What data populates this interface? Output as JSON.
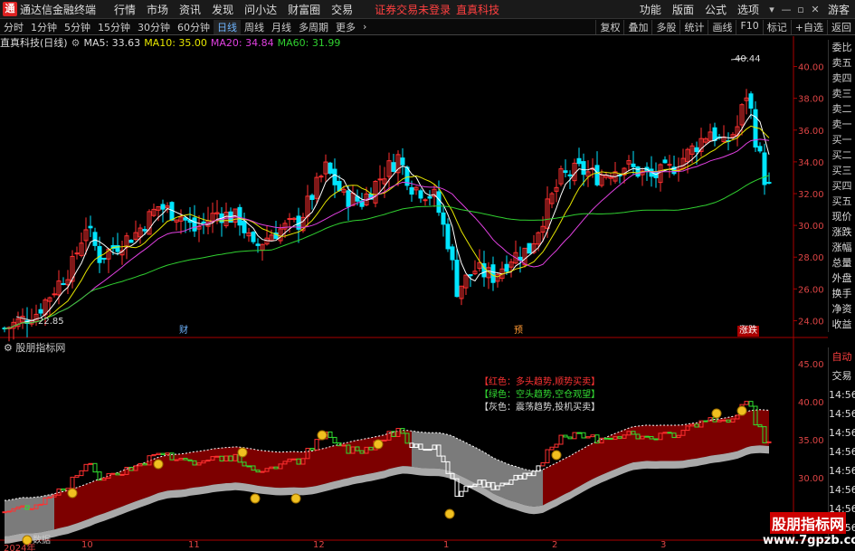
{
  "window": {
    "app_title": "通达信金融终端",
    "menus": [
      "行情",
      "市场",
      "资讯",
      "发现",
      "问小达",
      "财富圈",
      "交易"
    ],
    "warning": "证券交易未登录",
    "stock_title": "直真科技",
    "right_menus": [
      "功能",
      "版面",
      "公式",
      "选项",
      "画线"
    ],
    "guest": "游客"
  },
  "toolbar": {
    "periods": [
      "分时",
      "1分钟",
      "5分钟",
      "15分钟",
      "30分钟",
      "60分钟",
      "日线",
      "周线",
      "月线",
      "多周期",
      "更多"
    ],
    "active": "日线",
    "right_tools": [
      "复权",
      "叠加",
      "多股",
      "统计",
      "画线",
      "F10",
      "标记",
      "+自选",
      "返回"
    ]
  },
  "info": {
    "name": "直真科技(日线)",
    "ma5": "MA5: 33.63",
    "ma10": "MA10: 35.00",
    "ma20": "MA20: 34.84",
    "ma60": "MA60: 31.99"
  },
  "main_axis": [
    "40.00",
    "38.00",
    "36.00",
    "34.00",
    "32.00",
    "30.00",
    "28.00",
    "26.00",
    "24.00"
  ],
  "sub_axis": [
    "45.00",
    "40.00",
    "35.00",
    "30.00"
  ],
  "annotations": {
    "high": "40.44",
    "low": "22.85",
    "m1": "财",
    "m2": "预",
    "m3": "涨跌"
  },
  "right_panel": [
    "委比",
    "卖五",
    "卖四",
    "卖三",
    "卖二",
    "卖一",
    "买一",
    "买二",
    "买三",
    "买四",
    "买五",
    "现价",
    "涨跌",
    "涨幅",
    "总量",
    "外盘",
    "换手",
    "净资",
    "收益"
  ],
  "sub_right_panel": [
    "自动",
    "交易",
    "14:56",
    "14:56",
    "14:56",
    "14:56",
    "14:56",
    "14:56",
    "14:56",
    "14:56"
  ],
  "sub_panel": {
    "name": "股朋指标网",
    "data_label": "数据"
  },
  "legend": [
    "【红色：多头趋势,顺势买卖】",
    "【绿色：空头趋势,空仓观望】",
    "【灰色：震荡趋势,投机买卖】"
  ],
  "xaxis": [
    "2024年",
    "10",
    "11",
    "12",
    "1",
    "2",
    "3"
  ],
  "watermark": {
    "line1": "股朋指标网",
    "line2": "www.7gpzb.com"
  },
  "chart_data": {
    "type": "candlestick",
    "ylim": [
      23,
      41
    ],
    "high": 40.44,
    "low": 22.85,
    "series": [
      {
        "name": "MA5",
        "last": 33.63
      },
      {
        "name": "MA10",
        "last": 35.0
      },
      {
        "name": "MA20",
        "last": 34.84
      },
      {
        "name": "MA60",
        "last": 31.99
      }
    ]
  },
  "colors": {
    "up": "#ff3030",
    "down": "#00e5ff",
    "ma5": "#ffffff",
    "ma10": "#e6e600",
    "ma20": "#e040e0",
    "ma60": "#30d030",
    "band_red": "#8b0000",
    "band_gray": "#888888"
  }
}
